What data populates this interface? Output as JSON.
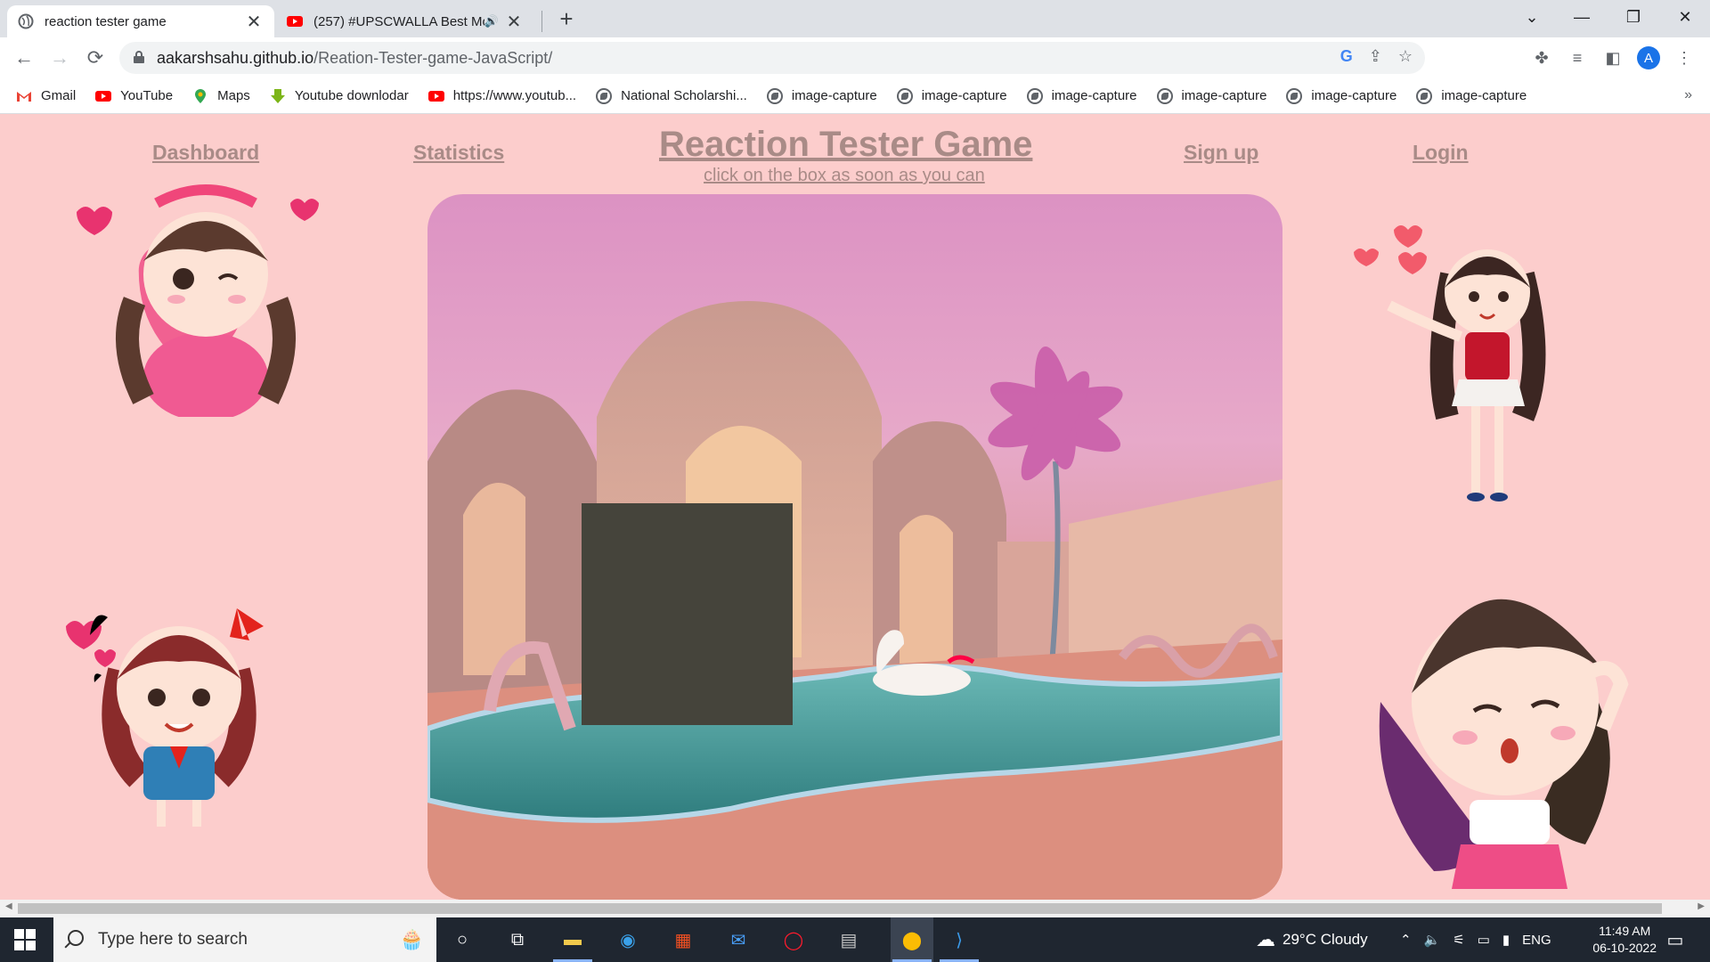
{
  "browser": {
    "tabs": [
      {
        "title": "reaction tester game",
        "icon": "globe-icon"
      },
      {
        "title": "(257) #UPSCWALLA Best Mo",
        "icon": "youtube-icon"
      }
    ],
    "address": {
      "host": "aakarshsahu.github.io",
      "path": "/Reation-Tester-game-JavaScript/"
    },
    "profile_initial": "A",
    "bookmarks": [
      {
        "label": "Gmail",
        "icon": "gmail-icon"
      },
      {
        "label": "YouTube",
        "icon": "youtube-icon"
      },
      {
        "label": "Maps",
        "icon": "maps-icon"
      },
      {
        "label": "Youtube downlodar",
        "icon": "download-icon"
      },
      {
        "label": "https://www.youtub...",
        "icon": "youtube-icon"
      },
      {
        "label": "National Scholarshi...",
        "icon": "globe-icon"
      },
      {
        "label": "image-capture",
        "icon": "globe-icon"
      },
      {
        "label": "image-capture",
        "icon": "globe-icon"
      },
      {
        "label": "image-capture",
        "icon": "globe-icon"
      },
      {
        "label": "image-capture",
        "icon": "globe-icon"
      },
      {
        "label": "image-capture",
        "icon": "globe-icon"
      },
      {
        "label": "image-capture",
        "icon": "globe-icon"
      }
    ],
    "more_bookmarks": "»"
  },
  "page": {
    "nav": {
      "dashboard": "Dashboard",
      "statistics": "Statistics",
      "signup": "Sign up",
      "login": "Login"
    },
    "title": "Reaction Tester Game",
    "subtitle": "click on the box as soon as you can",
    "box_color": "#45443b",
    "text_color": "#a98b87",
    "background_color": "#fccdcc"
  },
  "taskbar": {
    "search_placeholder": "Type here to search",
    "weather": "29°C  Cloudy",
    "language": "ENG",
    "time": "11:49 AM",
    "date": "06-10-2022"
  }
}
